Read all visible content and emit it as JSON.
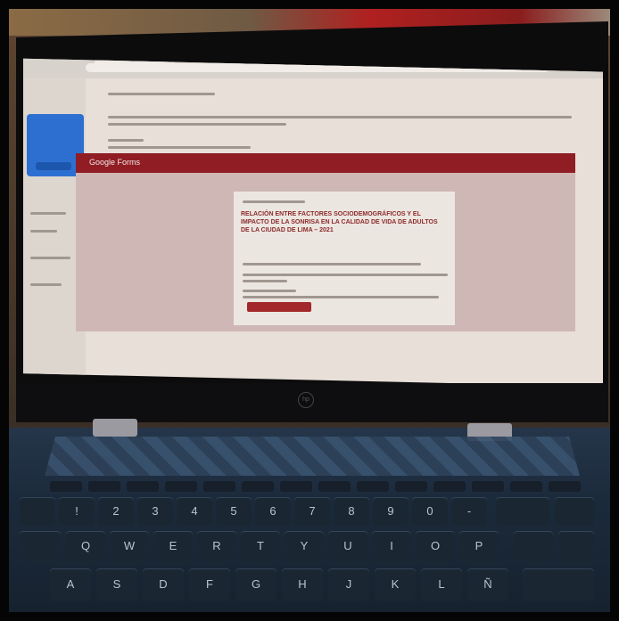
{
  "photo": {
    "subject": "laptop-showing-google-forms-invitation-email",
    "colors": {
      "screen_bg": "#e7dfd8",
      "forms_banner": "#8f1d23",
      "forms_body": "#cfb7b5",
      "title_text": "#8c2b2b",
      "button": "#a3282c",
      "keyboard": "#1b2633"
    }
  },
  "screen": {
    "banner_logo": "Google Forms",
    "form_title": "RELACIÓN ENTRE FACTORES SOCIODEMOGRÁFICOS Y EL IMPACTO DE LA SONRISA EN LA CALIDAD DE VIDA DE ADULTOS DE LA CIUDAD DE LIMA – 2021"
  },
  "keyboard": {
    "row_numbers": [
      "!",
      "2",
      "3",
      "4",
      "5",
      "6",
      "7",
      "8",
      "9",
      "0",
      "-"
    ],
    "row_qwerty": [
      "Q",
      "W",
      "E",
      "R",
      "T",
      "Y",
      "U",
      "I",
      "O",
      "P"
    ],
    "row_asdf": [
      "A",
      "S",
      "D",
      "F",
      "G",
      "H",
      "J",
      "K",
      "L",
      "Ñ"
    ]
  }
}
